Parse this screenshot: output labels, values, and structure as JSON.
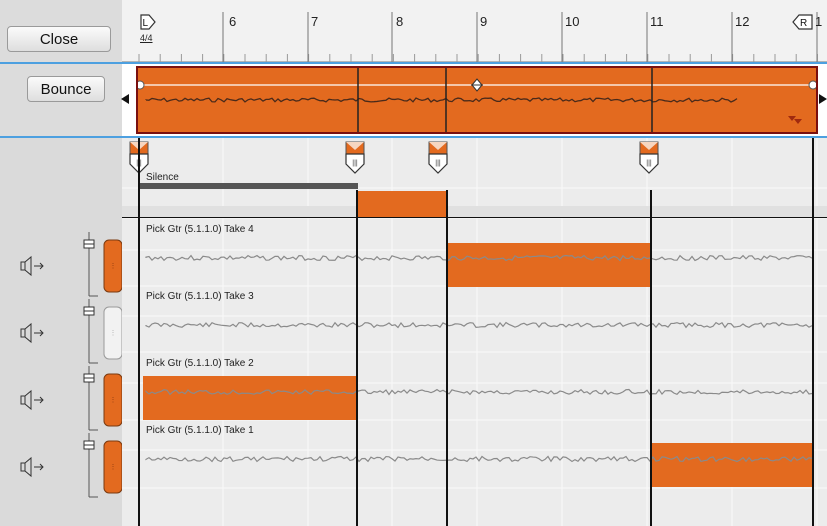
{
  "buttons": {
    "close": "Close",
    "bounce": "Bounce"
  },
  "ruler": {
    "time_signature": "4/4",
    "locator_left": "L",
    "locator_right": "R",
    "bars": [
      "6",
      "7",
      "8",
      "9",
      "10",
      "11",
      "12",
      "1"
    ]
  },
  "silence_label": "Silence",
  "lanes": [
    {
      "label": "Pick Gtr (5.1.1.0) Take 4",
      "active": true
    },
    {
      "label": "Pick Gtr (5.1.1.0) Take 3",
      "active": false
    },
    {
      "label": "Pick Gtr (5.1.1.0) Take 2",
      "active": true
    },
    {
      "label": "Pick Gtr (5.1.1.0) Take 1",
      "active": true
    }
  ],
  "icons": {
    "speaker": "speaker-arrow-icon",
    "fader": "fader-icon",
    "lane_toggle": "lane-enable-toggle",
    "comp_marker": "comp-marker-icon"
  },
  "colors": {
    "accent": "#e36a1f",
    "selection": "#4da0e0",
    "border_dark": "#7a0f0f"
  }
}
